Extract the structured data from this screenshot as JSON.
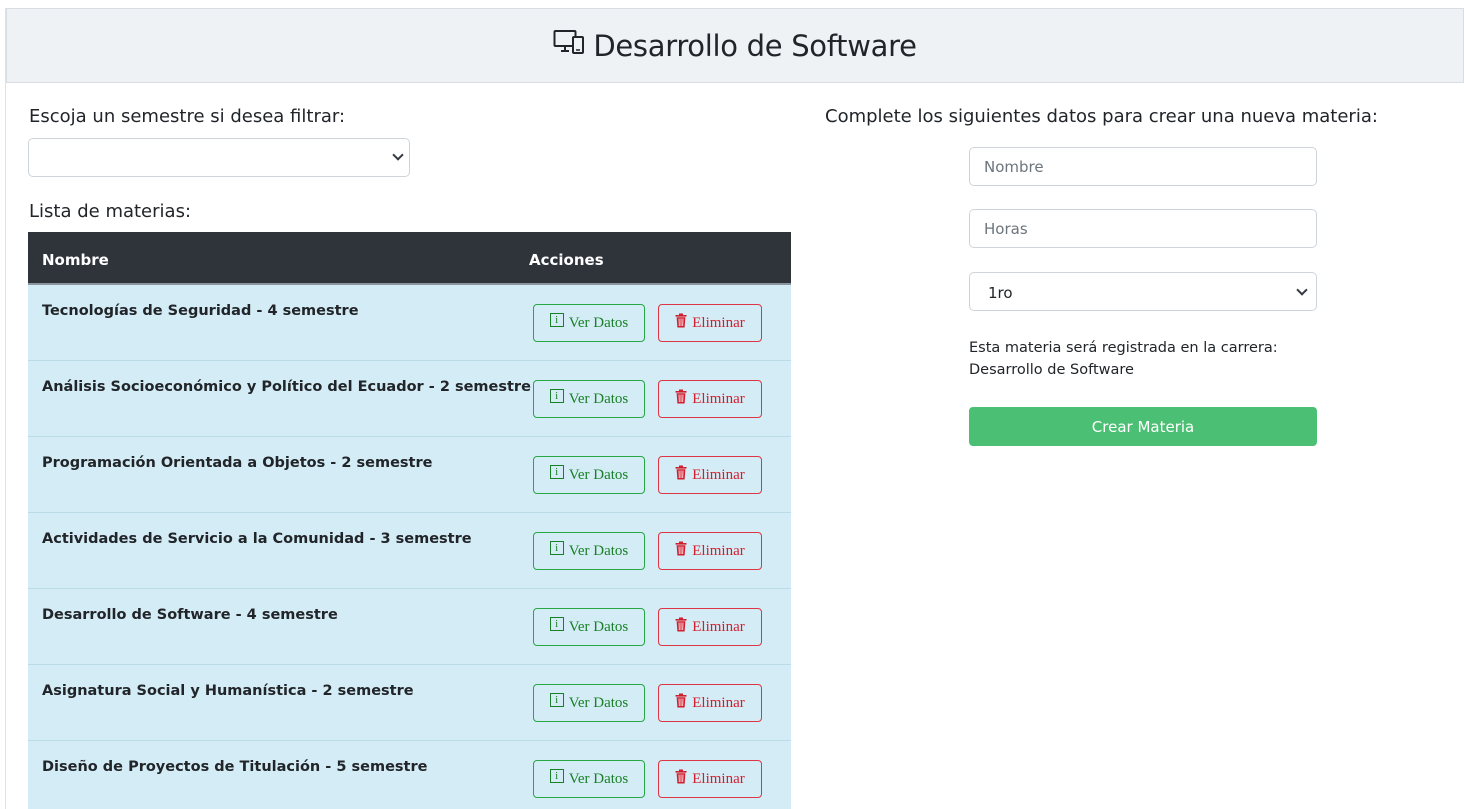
{
  "header": {
    "title": "Desarrollo de Software",
    "icon": "desktop-icon"
  },
  "filter": {
    "label": "Escoja un semestre si desea filtrar:",
    "selected": ""
  },
  "list": {
    "label": "Lista de materias:",
    "columns": [
      "Nombre",
      "Acciones"
    ],
    "view_label": "Ver Datos",
    "delete_label": "Eliminar",
    "rows": [
      {
        "name": "Tecnologías de Seguridad - 4 semestre"
      },
      {
        "name": "Análisis Socioeconómico y Político del Ecuador - 2 semestre"
      },
      {
        "name": "Programación Orientada a Objetos - 2 semestre"
      },
      {
        "name": "Actividades de Servicio a la Comunidad - 3 semestre"
      },
      {
        "name": "Desarrollo de Software - 4 semestre"
      },
      {
        "name": "Asignatura Social y Humanística - 2 semestre"
      },
      {
        "name": "Diseño de Proyectos de Titulación - 5 semestre"
      }
    ]
  },
  "form": {
    "title": "Complete los siguientes datos para crear una nueva materia:",
    "name_placeholder": "Nombre",
    "hours_placeholder": "Horas",
    "semester_selected": "1ro",
    "note_line1": "Esta materia será registrada en la carrera:",
    "note_line2": "Desarrollo de Software",
    "submit_label": "Crear Materia"
  },
  "colors": {
    "header_bg": "#eef2f5",
    "table_head_bg": "#2f343a",
    "row_bg": "#d4ecf5",
    "success": "#28a745",
    "danger": "#dc3545",
    "submit_bg": "#4bbf73"
  }
}
